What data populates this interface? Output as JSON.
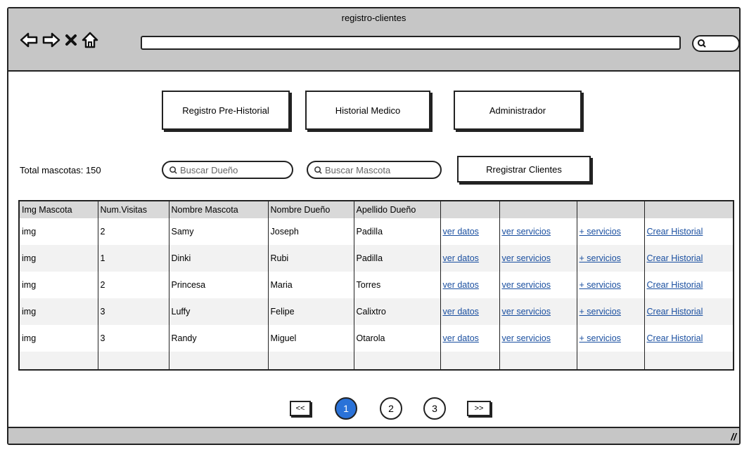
{
  "window": {
    "title": "registro-clientes"
  },
  "browser": {
    "icons": [
      "back-arrow-icon",
      "forward-arrow-icon",
      "close-icon",
      "home-icon",
      "search-icon"
    ],
    "url_value": ""
  },
  "nav": {
    "registro_prehistorial": "Registro Pre-Historial",
    "historial_medico": "Historial Medico",
    "administrador": "Administrador"
  },
  "toolbar": {
    "total_label": "Total mascotas: 150",
    "search_owner_placeholder": "Buscar Dueño",
    "search_pet_placeholder": "Buscar Mascota",
    "register_button": "Rregistrar Clientes"
  },
  "table": {
    "headers": [
      "Img Mascota",
      "Num.Visitas",
      "Nombre Mascota",
      "Nombre Dueño",
      "Apellido Dueño",
      "",
      "",
      "",
      ""
    ],
    "link_labels": {
      "ver_datos": "ver datos",
      "ver_servicios": "ver servicios",
      "add_servicios": "+ servicios",
      "crear_historial": "Crear Historial"
    },
    "rows": [
      {
        "img": "img",
        "visitas": "2",
        "mascota": "Samy",
        "dueno": "Joseph",
        "apellido": "Padilla"
      },
      {
        "img": "img",
        "visitas": "1",
        "mascota": "Dinki",
        "dueno": "Rubi",
        "apellido": "Padilla"
      },
      {
        "img": "img",
        "visitas": "2",
        "mascota": "Princesa",
        "dueno": "Maria",
        "apellido": "Torres"
      },
      {
        "img": "img",
        "visitas": "3",
        "mascota": "Luffy",
        "dueno": "Felipe",
        "apellido": "Calixtro"
      },
      {
        "img": "img",
        "visitas": "3",
        "mascota": "Randy",
        "dueno": "Miguel",
        "apellido": "Otarola"
      }
    ]
  },
  "pagination": {
    "prev": "<<",
    "pages": [
      "1",
      "2",
      "3"
    ],
    "current": "1",
    "next": ">>"
  },
  "colors": {
    "chrome": "#c6c6c6",
    "header_bg": "#d9d9d9",
    "link": "#1a4fa0",
    "active_page": "#2a72d8"
  }
}
